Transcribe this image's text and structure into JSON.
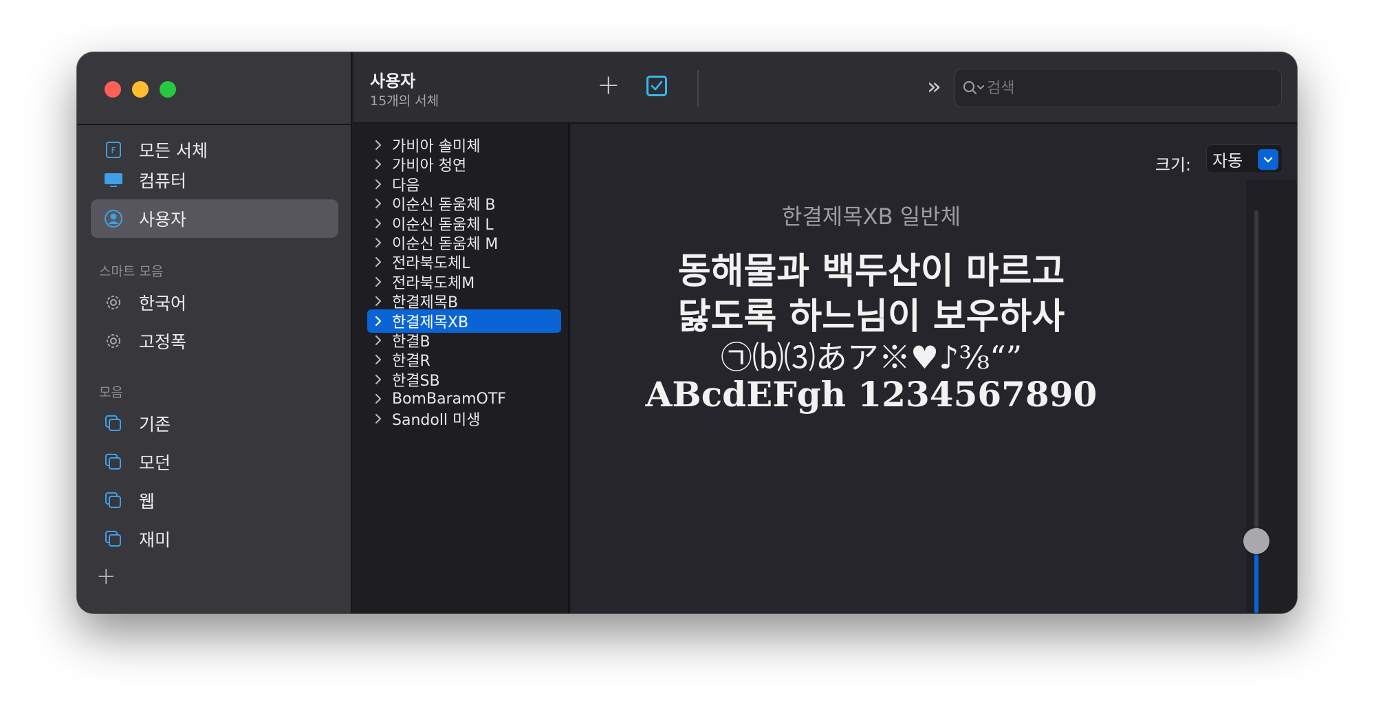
{
  "sidebar": {
    "items": [
      {
        "label": "모든 서체",
        "icon": "font-book-icon"
      },
      {
        "label": "컴퓨터",
        "icon": "computer-icon"
      },
      {
        "label": "사용자",
        "icon": "user-icon"
      }
    ],
    "smart_title": "스마트 모음",
    "smart": [
      {
        "label": "한국어",
        "icon": "gear-icon"
      },
      {
        "label": "고정폭",
        "icon": "gear-icon"
      }
    ],
    "collections_title": "모음",
    "collections": [
      {
        "label": "기존",
        "icon": "collection-icon"
      },
      {
        "label": "모던",
        "icon": "collection-icon"
      },
      {
        "label": "웹",
        "icon": "collection-icon"
      },
      {
        "label": "재미",
        "icon": "collection-icon"
      }
    ],
    "add": "+"
  },
  "toolbar": {
    "title": "사용자",
    "subtitle": "15개의 서체",
    "add": "+",
    "more": "»",
    "search_placeholder": "검색"
  },
  "fonts": [
    "가비아 솔미체",
    "가비아 청연",
    "다음",
    "이순신 돋움체 B",
    "이순신 돋움체 L",
    "이순신 돋움체 M",
    "전라북도체L",
    "전라북도체M",
    "한결제목B",
    "한결제목XB",
    "한결B",
    "한결R",
    "한결SB",
    "BomBaramOTF",
    "Sandoll 미생"
  ],
  "selected_font_index": 9,
  "preview": {
    "size_label": "크기:",
    "size_value": "자동",
    "font_name": "한결제목XB 일반체",
    "line1": "동해물과 백두산이 마르고",
    "line2": "닳도록 하느님이 보우하사",
    "line3": "㉠⒝⑶あア※♥♪⅜“”",
    "line4": "ABcdEFgh 1234567890",
    "slider_level": 0.18
  },
  "colors": {
    "accent": "#0a64d6",
    "checkbox": "#35b8f0",
    "red": "#fe5f57",
    "yellow": "#febc2e",
    "green": "#28c840"
  }
}
